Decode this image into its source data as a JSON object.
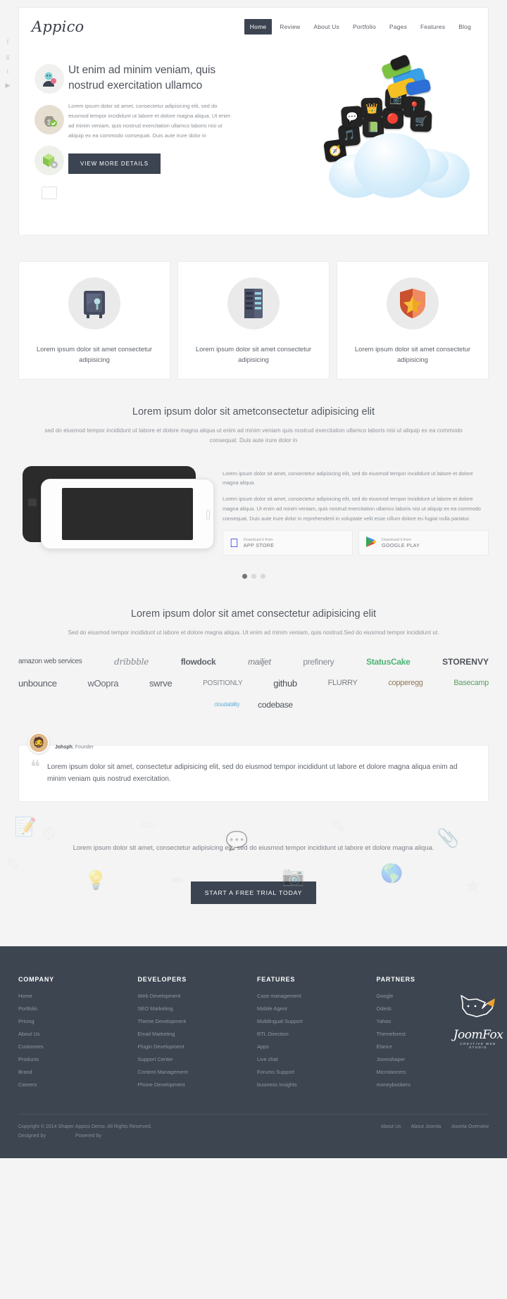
{
  "header": {
    "logo": "Appico",
    "nav": [
      {
        "label": "Home",
        "active": true
      },
      {
        "label": "Review",
        "active": false
      },
      {
        "label": "About Us",
        "active": false
      },
      {
        "label": "Portfolio",
        "active": false
      },
      {
        "label": "Pages",
        "active": false
      },
      {
        "label": "Features",
        "active": false
      },
      {
        "label": "Blog",
        "active": false
      }
    ]
  },
  "social": [
    {
      "name": "facebook-icon",
      "glyph": "f"
    },
    {
      "name": "google-plus-icon",
      "glyph": "g"
    },
    {
      "name": "twitter-icon",
      "glyph": "t"
    },
    {
      "name": "youtube-icon",
      "glyph": "▶"
    }
  ],
  "hero": {
    "side_icons": [
      "user-avatar-icon",
      "money-bag-icon",
      "package-gear-icon",
      "blank-card-icon"
    ],
    "title": "Ut enim ad minim veniam, quis nostrud exercitation ullamco",
    "paragraph": "Lorem ipsum dolor sit amet, consectetur adipisicing elit, sed do eiusmod tempor incididunt ut labore et dolore magna aliqua. Ut enim ad minim veniam, quis nostrud exercitation ullamco laboris nisi ut aliquip ex ea commodo consequat. Duis aute irure dolor in",
    "button": "VIEW MORE DETAILS",
    "art": "app-icons-cloud-illustration"
  },
  "features3": [
    {
      "icon": "safe-vault-icon",
      "glyph": "🗄",
      "text": "Lorem ipsum dolor sit amet consectetur adipisicing"
    },
    {
      "icon": "server-rack-icon",
      "glyph": "⌸",
      "text": "Lorem ipsum dolor sit amet consectetur adipisicing"
    },
    {
      "icon": "shield-star-icon",
      "glyph": "★",
      "text": "Lorem ipsum dolor sit amet consectetur adipisicing"
    }
  ],
  "section_app": {
    "title": "Lorem ipsum dolor sit ametconsectetur adipisicing elit",
    "subtitle": "sed do eiusmod tempor incididunt ut labore et dolore magna aliqua ut enim ad minim veniam quis nostrud exercitation ullamco laboris nisi ut aliquip ex ea commodo consequat. Duis aute irure dolor in",
    "paragraph1": "Lorem ipsum dolor sit amet, consectetur adipisicing elit, sed do eiusmod tempor incididunt ut labore et dolore magna aliqua.",
    "paragraph2": "Lorem ipsum dolor sit amet, consectetur adipisicing elit, sed do eiusmod tempor incididunt ut labore et dolore magna aliqua. Ut enim ad minim veniam, quis nostrud exercitation ullamco laboris nisi ut aliquip ex ea commodo consequat. Duis aute irure dolor in reprehenderit in voluptate velit esse cillum dolore eu fugiat nulla pariatur.",
    "stores": [
      {
        "icon": "apple-icon",
        "glyph": "",
        "small": "Download it from",
        "strong": "APP STORE"
      },
      {
        "icon": "google-play-icon",
        "glyph": "▶",
        "small": "Download it from",
        "strong": "GOOGLE PLAY"
      }
    ],
    "slider_dots": 3,
    "slider_active": 0
  },
  "section_clients": {
    "title": "Lorem ipsum dolor sit amet consectetur adipisicing elit",
    "subtitle": "Sed do eiusmod tempor incididunt ut labore et dolore magna aliqua. Ut enim ad minim veniam, quis nostrud.Sed do eiusmod tempor incididunt ut.",
    "rows": [
      [
        "amazon web services",
        "dribbble",
        "flowdock",
        "mailjet",
        "prefinery",
        "StatusCake",
        "STORENVY"
      ],
      [
        "unbounce",
        "wOopra",
        "swrve",
        "POSITIONLY",
        "github",
        "FLURRY",
        "copperegg",
        "Basecamp"
      ],
      [
        "cloudability",
        "codebase"
      ]
    ]
  },
  "testimonial": {
    "avatar": "user-photo-avatar",
    "name": "Johsph",
    "role": "Founder",
    "quote": "Lorem ipsum dolor sit amet, consectetur adipisicing elit, sed do eiusmod tempor incididunt ut labore et dolore magna aliqua enim ad minim veniam quis nostrud exercitation."
  },
  "cta": {
    "text": "Lorem ipsum dolor sit amet, consectetur adipisicing elit, sed do eiusmod tempor incididunt ut labore et dolore magna aliqua.",
    "button": "START A FREE TRIAL TODAY"
  },
  "footer": {
    "columns": [
      {
        "title": "COMPANY",
        "links": [
          "Home",
          "Portfolio",
          "Pricing",
          "About Us",
          "Customers",
          "Products",
          "Brand",
          "Careers"
        ]
      },
      {
        "title": "DEVELOPERS",
        "links": [
          "Web Development",
          "SEO Marketing",
          "Theme Development",
          "Email Marketing",
          "Plugin Development",
          "Support Center",
          "Content Management",
          "Phone Development"
        ]
      },
      {
        "title": "FEATURES",
        "links": [
          "Case management",
          "Mobile Agent",
          "Multilingual Support",
          "RTL Direction",
          "Apps",
          "Live chat",
          "Forums Support",
          "business Insights"
        ]
      },
      {
        "title": "PARTNERS",
        "links": [
          "Google",
          "Odesk",
          "Yahoo",
          "Themeforest",
          "Elance",
          "Joomshaper",
          "Microlancers",
          "moneybookers"
        ]
      }
    ],
    "brand": {
      "mark": "fox-logo-icon",
      "word": "JoomFox",
      "tagline": "CREATIVE WEB STUDIO"
    },
    "copyright": "Copyright © 2014 Shaper Appico Demo. All Rights Reserved.",
    "designed_by": "Designed by",
    "powered_by": "Powered by",
    "bottom_links": [
      "About Us",
      "About Joomla",
      "Joomla Overview"
    ]
  }
}
